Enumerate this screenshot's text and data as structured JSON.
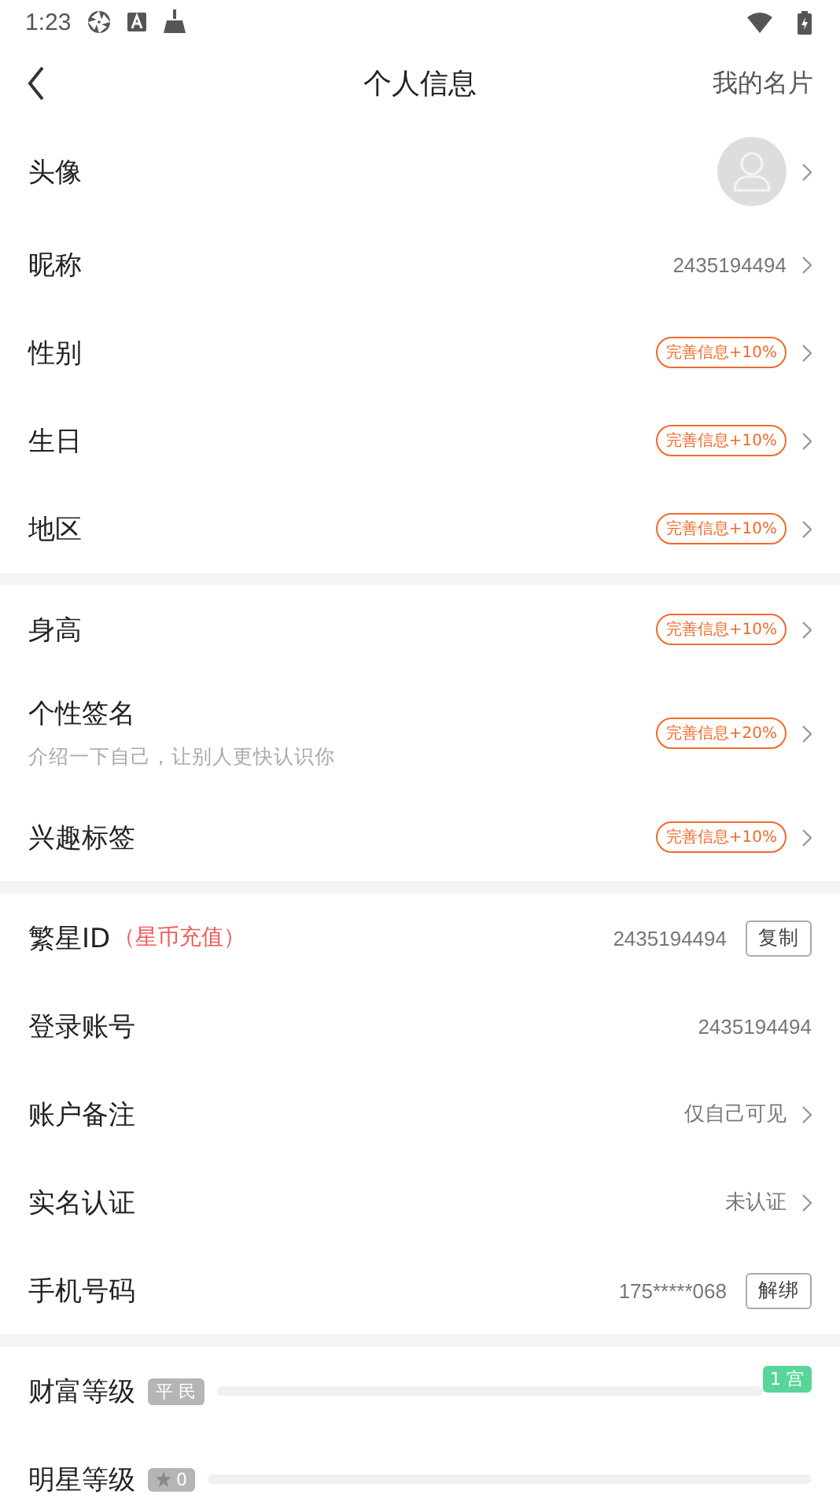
{
  "status_bar": {
    "time": "1:23"
  },
  "nav": {
    "title": "个人信息",
    "action": "我的名片"
  },
  "sections": [
    {
      "rows": [
        {
          "kind": "avatar",
          "label": "头像",
          "chevron": true
        },
        {
          "kind": "text",
          "label": "昵称",
          "value": "2435194494",
          "chevron": true
        },
        {
          "kind": "text",
          "label": "性别",
          "badge": "完善信息+10%",
          "chevron": true
        },
        {
          "kind": "text",
          "label": "生日",
          "badge": "完善信息+10%",
          "chevron": true
        },
        {
          "kind": "text",
          "label": "地区",
          "badge": "完善信息+10%",
          "chevron": true
        }
      ]
    },
    {
      "rows": [
        {
          "kind": "text",
          "label": "身高",
          "badge": "完善信息+10%",
          "chevron": true
        },
        {
          "kind": "text",
          "label": "个性签名",
          "sub": "介绍一下自己，让别人更快认识你",
          "badge": "完善信息+20%",
          "chevron": true
        },
        {
          "kind": "text",
          "label": "兴趣标签",
          "badge": "完善信息+10%",
          "chevron": true
        }
      ]
    },
    {
      "rows": [
        {
          "kind": "text",
          "label": "繁星ID",
          "link": "（星币充值）",
          "value": "2435194494",
          "button": "复制",
          "chevron": false
        },
        {
          "kind": "text",
          "label": "登录账号",
          "value": "2435194494",
          "chevron": false
        },
        {
          "kind": "text",
          "label": "账户备注",
          "value": "仅自己可见",
          "chevron": true
        },
        {
          "kind": "text",
          "label": "实名认证",
          "value": "未认证",
          "chevron": true
        },
        {
          "kind": "text",
          "label": "手机号码",
          "value": "175*****068",
          "button": "解绑",
          "chevron": false
        }
      ]
    },
    {
      "rows": [
        {
          "kind": "level",
          "label": "财富等级",
          "grade": "平 民",
          "next": "1 宫"
        },
        {
          "kind": "level",
          "label": "明星等级",
          "grade": "0",
          "star": true
        }
      ]
    }
  ]
}
